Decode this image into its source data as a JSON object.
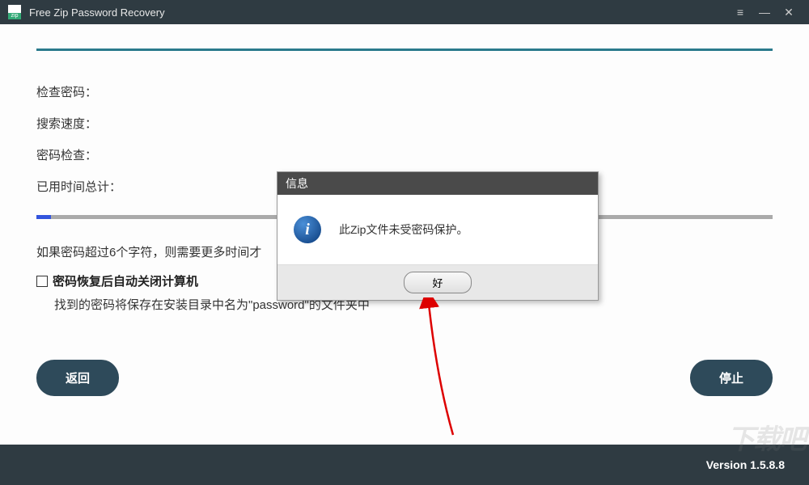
{
  "titlebar": {
    "title": "Free Zip Password Recovery"
  },
  "status": {
    "check_password": "检查密码：",
    "search_speed": "搜索速度：",
    "password_check": "密码检查：",
    "elapsed_total": "已用时间总计："
  },
  "hint": "如果密码超过6个字符，则需要更多时间才",
  "checkbox_label": "密码恢复后自动关闭计算机",
  "sub_hint": "找到的密码将保存在安装目录中名为\"password\"的文件夹中",
  "buttons": {
    "back": "返回",
    "stop": "停止"
  },
  "footer": {
    "version": "Version 1.5.8.8"
  },
  "dialog": {
    "title": "信息",
    "message": "此Zip文件未受密码保护。",
    "ok": "好"
  },
  "watermark": "下载吧"
}
